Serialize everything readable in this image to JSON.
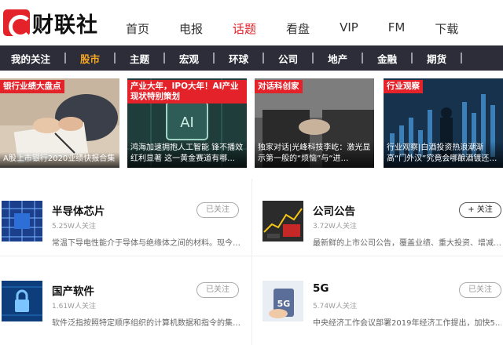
{
  "brand": {
    "logo_text": "财联社",
    "logo_color": "#e32229"
  },
  "top_nav": [
    "首页",
    "电报",
    "话题",
    "看盘",
    "VIP",
    "FM",
    "下载"
  ],
  "top_nav_active": "话题",
  "category_bar": [
    "我的关注",
    "股市",
    "主题",
    "宏观",
    "环球",
    "公司",
    "地产",
    "金融",
    "期货"
  ],
  "category_active": "股市",
  "banners": [
    {
      "tag": "银行业绩大盘点",
      "caption": "A股上市银行2020业绩快报合集"
    },
    {
      "tag": "产业大年，IPO大年！AI产业现状特别策划",
      "caption": "鸿海加速拥抱人工智能 锋不播效红利显著 这一黄金赛道有哪…"
    },
    {
      "tag": "对话科创家",
      "caption": "独家对话|光峰科技李屹：激光显示第一般的“烦恼”与“进…"
    },
    {
      "tag": "行业观察",
      "caption": "行业观察|白酒投资热浪潮渐高“门外汉”究竟会哪酿酒镀还…"
    }
  ],
  "topics": [
    {
      "name": "半导体芯片",
      "followers": "5.25W人关注",
      "desc": "常温下导电性能介于导体与绝缘体之间的材料。现今…",
      "follow_label": "已关注",
      "following": true,
      "icon": "chip-icon"
    },
    {
      "name": "公司公告",
      "followers": "3.72W人关注",
      "desc": "最新鲜的上市公司公告，覆盖业绩、重大投资、增减…",
      "follow_label": "+ 关注",
      "following": false,
      "icon": "announcement-icon"
    },
    {
      "name": "国产软件",
      "followers": "1.61W人关注",
      "desc": "软件泛指按照特定顺序组织的计算机数据和指令的集…",
      "follow_label": "已关注",
      "following": true,
      "icon": "lock-icon"
    },
    {
      "name": "5G",
      "followers": "5.74W人关注",
      "desc": "中央经济工作会议部署2019年经济工作提出，加快5…",
      "follow_label": "已关注",
      "following": true,
      "icon": "5g-icon"
    }
  ]
}
